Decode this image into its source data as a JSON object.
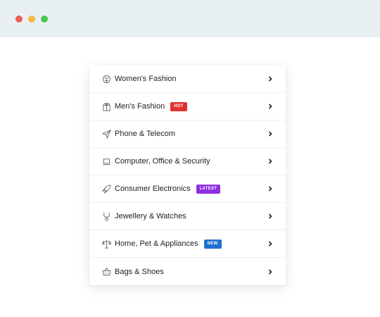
{
  "window": {
    "colors": {
      "red": "#ed5e56",
      "yellow": "#f4bc3e",
      "green": "#4fc44f"
    }
  },
  "menu": {
    "items": [
      {
        "label": "Women's Fashion",
        "icon": "dress-icon"
      },
      {
        "label": "Men's Fashion",
        "icon": "shirt-icon",
        "badge": "HOT",
        "badge_color": "#e03131"
      },
      {
        "label": "Phone & Telecom",
        "icon": "send-icon"
      },
      {
        "label": "Computer, Office & Security",
        "icon": "laptop-icon"
      },
      {
        "label": "Consumer Electronics",
        "icon": "rocket-icon",
        "badge": "LATEST",
        "badge_color": "#8e2de2"
      },
      {
        "label": "Jewellery & Watches",
        "icon": "jewelry-icon"
      },
      {
        "label": "Home, Pet & Appliances",
        "icon": "scale-icon",
        "badge": "NEW",
        "badge_color": "#1f6fcf"
      },
      {
        "label": "Bags & Shoes",
        "icon": "basket-icon"
      }
    ]
  }
}
